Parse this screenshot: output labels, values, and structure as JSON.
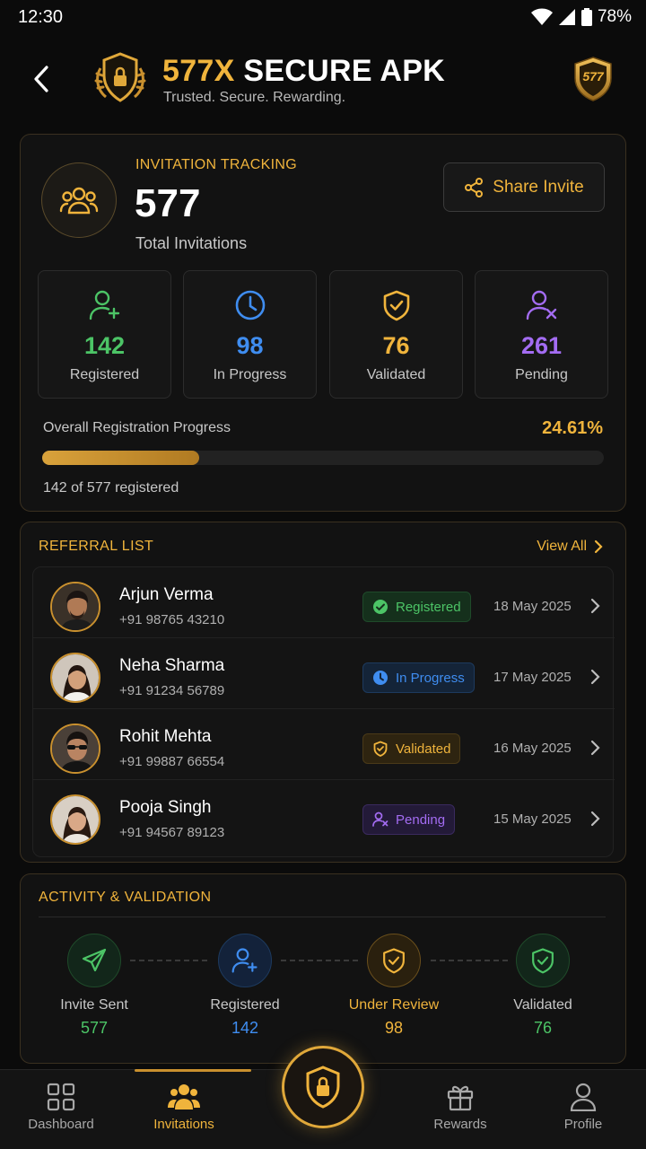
{
  "status_bar": {
    "time": "12:30",
    "battery": "78%"
  },
  "header": {
    "title_accent": "577X",
    "title_rest": " SECURE APK",
    "subtitle": "Trusted. Secure. Rewarding.",
    "badge_text": "577"
  },
  "tracking": {
    "label": "INVITATION TRACKING",
    "total": "577",
    "total_label": "Total Invitations",
    "share_label": "Share Invite",
    "stats": [
      {
        "value": "142",
        "label": "Registered",
        "color": "#4cc466",
        "icon": "user-plus-icon"
      },
      {
        "value": "98",
        "label": "In Progress",
        "color": "#3f8df0",
        "icon": "clock-icon"
      },
      {
        "value": "76",
        "label": "Validated",
        "color": "#f0b43c",
        "icon": "shield-check-icon"
      },
      {
        "value": "261",
        "label": "Pending",
        "color": "#a36cf2",
        "icon": "user-x-icon"
      }
    ],
    "progress_label": "Overall Registration Progress",
    "progress_pct": "24.61%",
    "progress_value": 0.2461,
    "progress_note": "142 of 577 registered"
  },
  "referrals": {
    "title": "REFERRAL LIST",
    "view_all": "View All",
    "items": [
      {
        "name": "Arjun Verma",
        "phone": "+91 98765 43210",
        "status": "Registered",
        "date": "18 May 2025"
      },
      {
        "name": "Neha Sharma",
        "phone": "+91 91234 56789",
        "status": "In Progress",
        "date": "17 May 2025"
      },
      {
        "name": "Rohit Mehta",
        "phone": "+91 99887 66554",
        "status": "Validated",
        "date": "16 May 2025"
      },
      {
        "name": "Pooja Singh",
        "phone": "+91 94567 89123",
        "status": "Pending",
        "date": "15 May 2025"
      }
    ]
  },
  "activity": {
    "title": "ACTIVITY & VALIDATION",
    "steps": [
      {
        "label": "Invite Sent",
        "value": "577",
        "color": "#4cc466"
      },
      {
        "label": "Registered",
        "value": "142",
        "color": "#3f8df0"
      },
      {
        "label": "Under Review",
        "value": "98",
        "color": "#f0b43c"
      },
      {
        "label": "Validated",
        "value": "76",
        "color": "#4cc466"
      }
    ]
  },
  "nav": {
    "items": [
      {
        "label": "Dashboard"
      },
      {
        "label": "Invitations"
      },
      {
        "label": "Rewards"
      },
      {
        "label": "Profile"
      }
    ],
    "active": "Invitations"
  },
  "colors": {
    "accent": "#f0b43c",
    "green": "#4cc466",
    "blue": "#3f8df0",
    "purple": "#a36cf2"
  }
}
